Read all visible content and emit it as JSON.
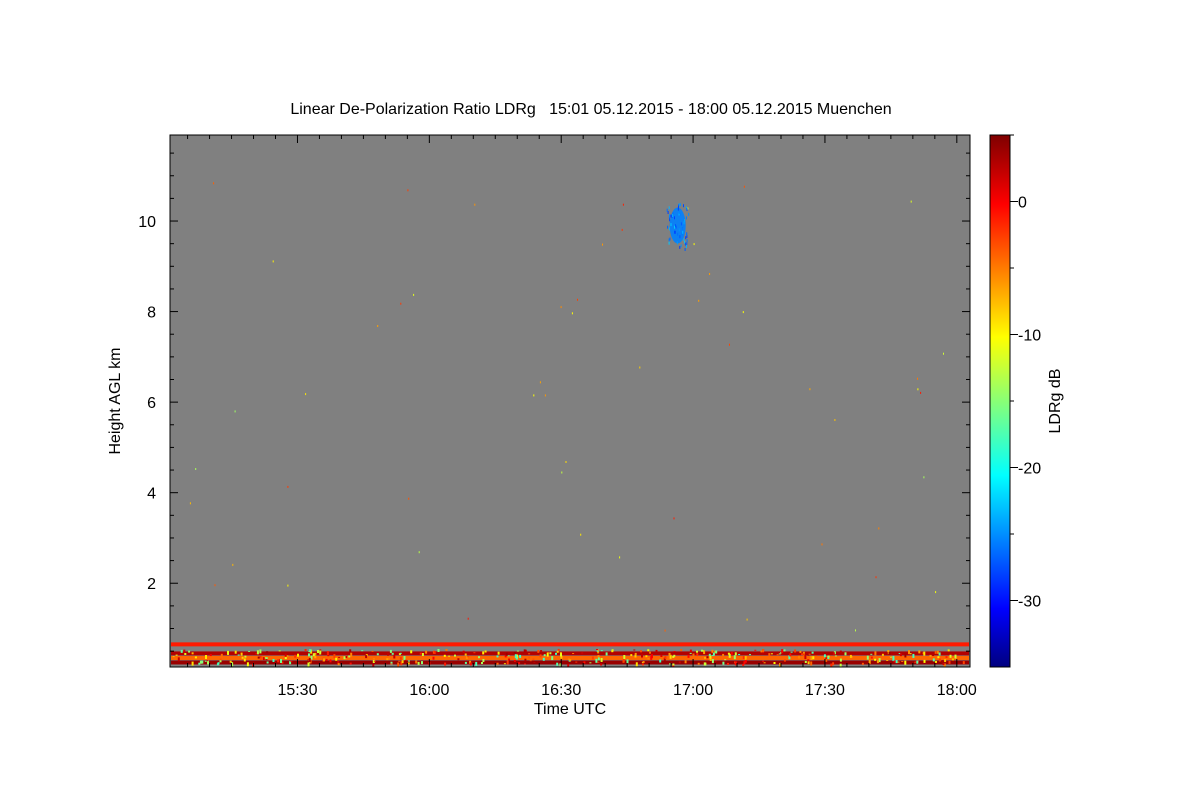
{
  "chart_data": {
    "type": "heatmap",
    "title": "Linear De-Polarization Ratio LDRg   15:01 05.12.2015 - 18:00 05.12.2015 Muenchen",
    "xlabel": "Time UTC",
    "ylabel": "Height AGL km",
    "x_range_minutes_utc": [
      901,
      1083
    ],
    "y_range_km": [
      0.15,
      11.9
    ],
    "x_ticks": [
      {
        "minute": 930,
        "label": "15:30"
      },
      {
        "minute": 960,
        "label": "16:00"
      },
      {
        "minute": 990,
        "label": "16:30"
      },
      {
        "minute": 1020,
        "label": "17:00"
      },
      {
        "minute": 1050,
        "label": "17:30"
      },
      {
        "minute": 1080,
        "label": "18:00"
      }
    ],
    "y_ticks": [
      {
        "value": 2,
        "label": "2"
      },
      {
        "value": 4,
        "label": "4"
      },
      {
        "value": 6,
        "label": "6"
      },
      {
        "value": 8,
        "label": "8"
      },
      {
        "value": 10,
        "label": "10"
      }
    ],
    "colorbar": {
      "label": "LDRg dB",
      "range": [
        -35,
        5
      ],
      "colormap": "jet",
      "ticks": [
        {
          "value": 0,
          "label": "0"
        },
        {
          "value": -10,
          "label": "-10"
        },
        {
          "value": -20,
          "label": "-20"
        },
        {
          "value": -30,
          "label": "-30"
        }
      ]
    },
    "background_color": "#808080",
    "layers": [
      {
        "name": "near-ground layer",
        "height_km": 0.65,
        "ldr_db": -1
      },
      {
        "name": "near-ground layer",
        "height_km": 0.45,
        "ldr_db": 3
      },
      {
        "name": "near-ground layer",
        "height_km": 0.35,
        "ldr_db": -4
      },
      {
        "name": "near-ground layer",
        "height_km": 0.25,
        "ldr_db": 4
      }
    ],
    "features": [
      {
        "name": "ice cloud",
        "time_minute": 1016.5,
        "height_km": 9.9,
        "ldr_db": -25
      }
    ]
  }
}
